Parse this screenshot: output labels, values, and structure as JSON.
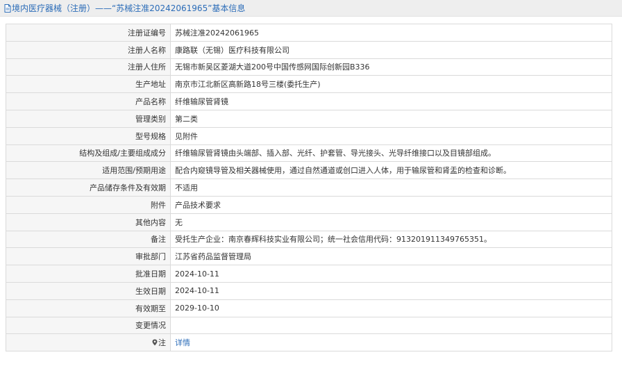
{
  "header": {
    "title": "境内医疗器械（注册）——“苏械注准20242061965”基本信息",
    "icon": "document-icon"
  },
  "rows": [
    {
      "label": "注册证编号",
      "value": "苏械注准20242061965"
    },
    {
      "label": "注册人名称",
      "value": "康路联（无锡）医疗科技有限公司"
    },
    {
      "label": "注册人住所",
      "value": "无锡市新吴区菱湖大道200号中国传感网国际创新园B336"
    },
    {
      "label": "生产地址",
      "value": "南京市江北新区高新路18号三楼(委托生产)"
    },
    {
      "label": "产品名称",
      "value": "纤维输尿管肾镜"
    },
    {
      "label": "管理类别",
      "value": "第二类"
    },
    {
      "label": "型号规格",
      "value": "见附件"
    },
    {
      "label": "结构及组成/主要组成成分",
      "value": "纤维输尿管肾镜由头端部、插入部、光纤、护套管、导光接头、光导纤维接口以及目镜部组成。"
    },
    {
      "label": "适用范围/预期用途",
      "value": "配合内窥镜导管及相关器械使用，通过自然通道或创口进入人体，用于输尿管和肾盂的检查和诊断。"
    },
    {
      "label": "产品储存条件及有效期",
      "value": "不适用"
    },
    {
      "label": "附件",
      "value": "产品技术要求"
    },
    {
      "label": "其他内容",
      "value": "无"
    },
    {
      "label": "备注",
      "value": "受托生产企业：南京春辉科技实业有限公司；统一社会信用代码：913201911349765351。"
    },
    {
      "label": "审批部门",
      "value": "江苏省药品监督管理局"
    },
    {
      "label": "批准日期",
      "value": "2024-10-11"
    },
    {
      "label": "生效日期",
      "value": "2024-10-11"
    },
    {
      "label": "有效期至",
      "value": "2029-10-10"
    },
    {
      "label": "变更情况",
      "value": ""
    }
  ],
  "note_row": {
    "label": "注",
    "icon": "pin-icon",
    "link_text": "详情"
  },
  "colors": {
    "link": "#2b6cb8",
    "label_bg": "#f6f6f6",
    "border": "#dadada",
    "header_bg": "#eeeeee"
  }
}
